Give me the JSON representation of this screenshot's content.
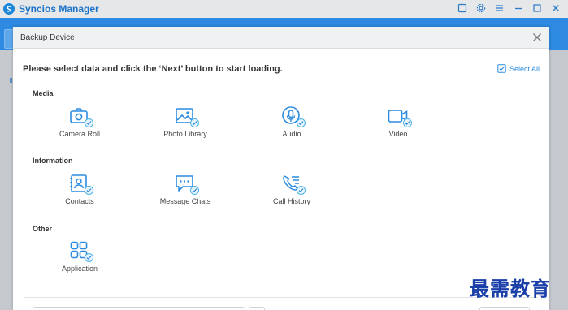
{
  "app": {
    "title": "Syncios Manager"
  },
  "dialog": {
    "title": "Backup Device",
    "instruction": "Please select data and click the ‘Next’ button to start loading.",
    "select_all_label": "Select All"
  },
  "sections": {
    "media": {
      "label": "Media",
      "items": [
        {
          "label": "Camera Roll",
          "icon": "camera-icon"
        },
        {
          "label": "Photo Library",
          "icon": "photo-icon"
        },
        {
          "label": "Audio",
          "icon": "microphone-icon"
        },
        {
          "label": "Video",
          "icon": "video-camera-icon"
        }
      ]
    },
    "information": {
      "label": "Information",
      "items": [
        {
          "label": "Contacts",
          "icon": "contacts-icon"
        },
        {
          "label": "Message Chats",
          "icon": "chat-icon"
        },
        {
          "label": "Call History",
          "icon": "phone-list-icon"
        }
      ]
    },
    "other": {
      "label": "Other",
      "items": [
        {
          "label": "Application",
          "icon": "apps-grid-icon"
        }
      ]
    }
  },
  "watermark": "最需教育",
  "colors": {
    "accent": "#2b8be0",
    "header": "#2d8ae0",
    "check": "#4ab3e8"
  }
}
